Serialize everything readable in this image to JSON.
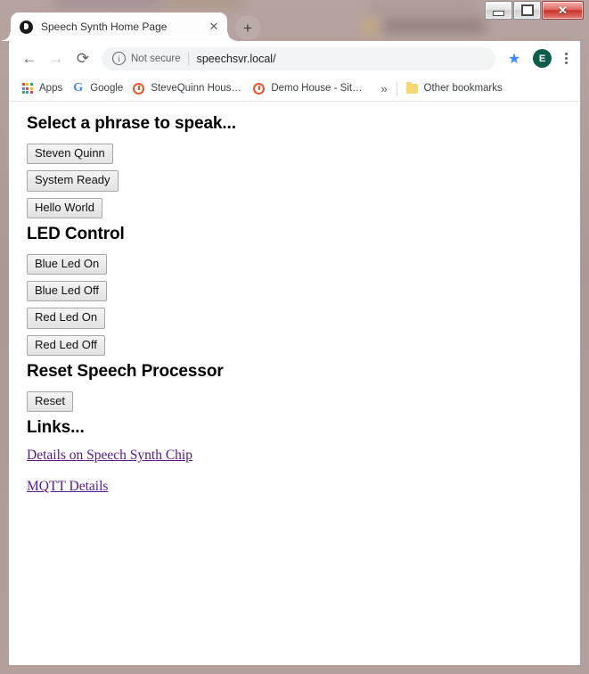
{
  "window": {
    "controls": {
      "minimize": "minimize",
      "maximize": "maximize",
      "close": "✕"
    }
  },
  "browser": {
    "tab": {
      "title": "Speech Synth Home Page",
      "favicon": "speech-bubble-icon",
      "close_label": "✕"
    },
    "new_tab_label": "+",
    "toolbar": {
      "back_label": "←",
      "forward_label": "→",
      "reload_label": "⟳",
      "security_icon": "info-icon",
      "security_text": "Not secure",
      "url": "speechsvr.local/",
      "star_label": "★",
      "avatar_initial": "E",
      "avatar_color": "#0d5c4c",
      "menu_label": "kebab-menu"
    },
    "bookmarks": [
      {
        "label": "Apps",
        "icon": "apps-grid-icon"
      },
      {
        "label": "Google",
        "icon": "google-g-icon"
      },
      {
        "label": "SteveQuinn Househ...",
        "icon": "openhab-icon"
      },
      {
        "label": "Demo House - Site ...",
        "icon": "openhab-icon"
      }
    ],
    "bookmarks_overflow_label": "»",
    "other_bookmarks": {
      "label": "Other bookmarks",
      "icon": "folder-icon"
    }
  },
  "page": {
    "sections": {
      "phrases": {
        "heading": "Select a phrase to speak...",
        "buttons": [
          "Steven Quinn",
          "System Ready",
          "Hello World"
        ]
      },
      "led": {
        "heading": "LED Control",
        "buttons": [
          "Blue Led On",
          "Blue Led Off",
          "Red Led On",
          "Red Led Off"
        ]
      },
      "reset": {
        "heading": "Reset Speech Processor",
        "buttons": [
          "Reset"
        ]
      },
      "links": {
        "heading": "Links...",
        "items": [
          "Details on Speech Synth Chip",
          "MQTT Details"
        ]
      }
    }
  }
}
